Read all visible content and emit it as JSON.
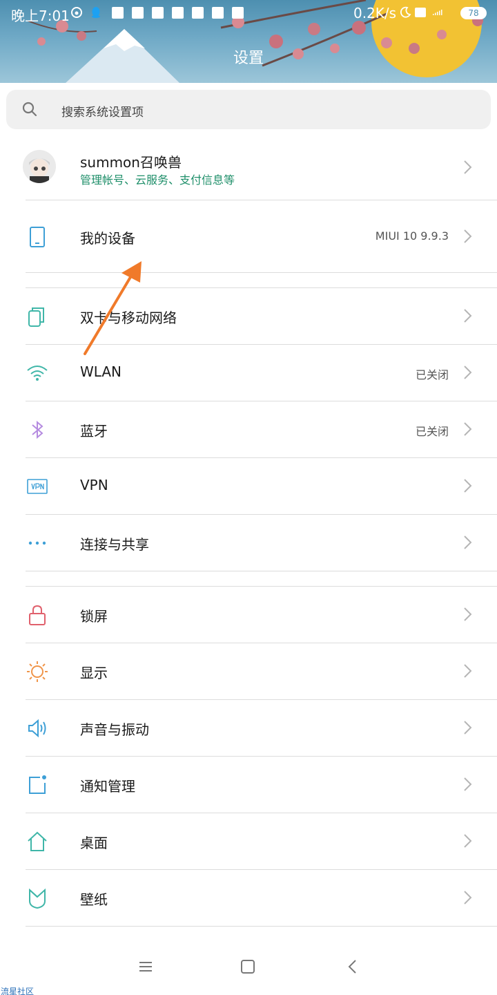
{
  "status_bar": {
    "time": "晚上7:01",
    "net_speed": "0.2K/s",
    "battery": "78"
  },
  "header": {
    "title": "设置"
  },
  "search": {
    "placeholder": "搜索系统设置项"
  },
  "account": {
    "name": "summon召唤兽",
    "subtitle": "管理帐号、云服务、支付信息等"
  },
  "my_device": {
    "label": "我的设备",
    "value": "MIUI 10 9.9.3"
  },
  "network_items": [
    {
      "label": "双卡与移动网络",
      "value": ""
    },
    {
      "label": "WLAN",
      "value": "已关闭"
    },
    {
      "label": "蓝牙",
      "value": "已关闭"
    },
    {
      "label": "VPN",
      "value": ""
    },
    {
      "label": "连接与共享",
      "value": ""
    }
  ],
  "display_items": [
    {
      "label": "锁屏"
    },
    {
      "label": "显示"
    },
    {
      "label": "声音与振动"
    },
    {
      "label": "通知管理"
    },
    {
      "label": "桌面"
    },
    {
      "label": "壁纸"
    }
  ],
  "icons": {
    "device": "phone-icon",
    "sim": "dual-sim-icon",
    "wlan": "wifi-icon",
    "bluetooth": "bluetooth-icon",
    "vpn": "vpn-icon",
    "share": "more-dots-icon",
    "lock": "lock-icon",
    "display": "sun-icon",
    "sound": "speaker-icon",
    "notification": "notification-icon",
    "home": "home-icon",
    "wallpaper": "wallpaper-icon"
  },
  "colors": {
    "accent_green": "#1f8f6a",
    "icon_blue": "#3d9fd6",
    "icon_teal": "#3fb6a8",
    "icon_purple": "#b58be0",
    "icon_red": "#e0606c",
    "icon_orange": "#f0954a",
    "annotation_arrow": "#f07a2a"
  },
  "watermark": "流星社区"
}
